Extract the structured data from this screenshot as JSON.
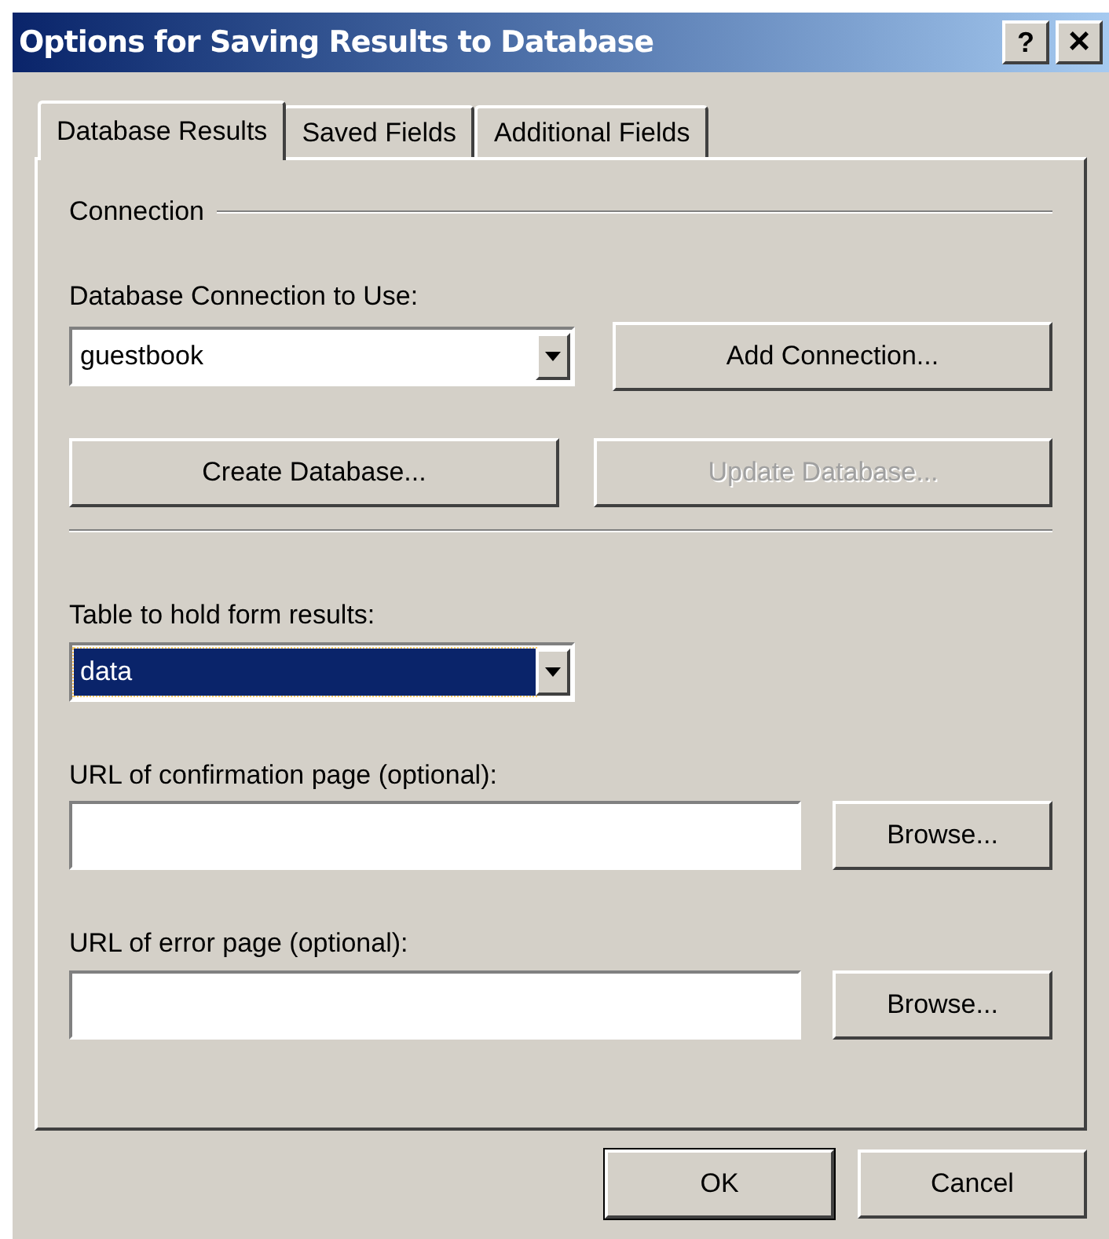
{
  "window": {
    "title": "Options for Saving Results to Database",
    "buttons": [
      {
        "kind": "help",
        "label": "?"
      },
      {
        "kind": "close",
        "label": "×"
      }
    ]
  },
  "tabs": [
    {
      "label": "Database Results",
      "selected": true
    },
    {
      "label": "Saved Fields",
      "selected": false
    },
    {
      "label": "Additional Fields",
      "selected": false
    }
  ],
  "connection": {
    "group_label": "Connection",
    "label": "Database Connection to Use:",
    "value": "guestbook",
    "highlighted": false,
    "add_button": {
      "label": "Add Connection...",
      "disabled": false
    },
    "create_button": {
      "label": "Create Database...",
      "disabled": false
    },
    "update_button": {
      "label": "Update Database...",
      "disabled": true
    }
  },
  "table": {
    "label": "Table to hold form results:",
    "value": "data",
    "highlighted": true
  },
  "url_fields": [
    {
      "label": "URL of confirmation page (optional):",
      "button": "Browse..."
    },
    {
      "label": "URL of error page (optional):",
      "button": "Browse..."
    }
  ],
  "footer_buttons": [
    {
      "label": "OK",
      "default": true
    },
    {
      "label": "Cancel",
      "default": false
    }
  ]
}
